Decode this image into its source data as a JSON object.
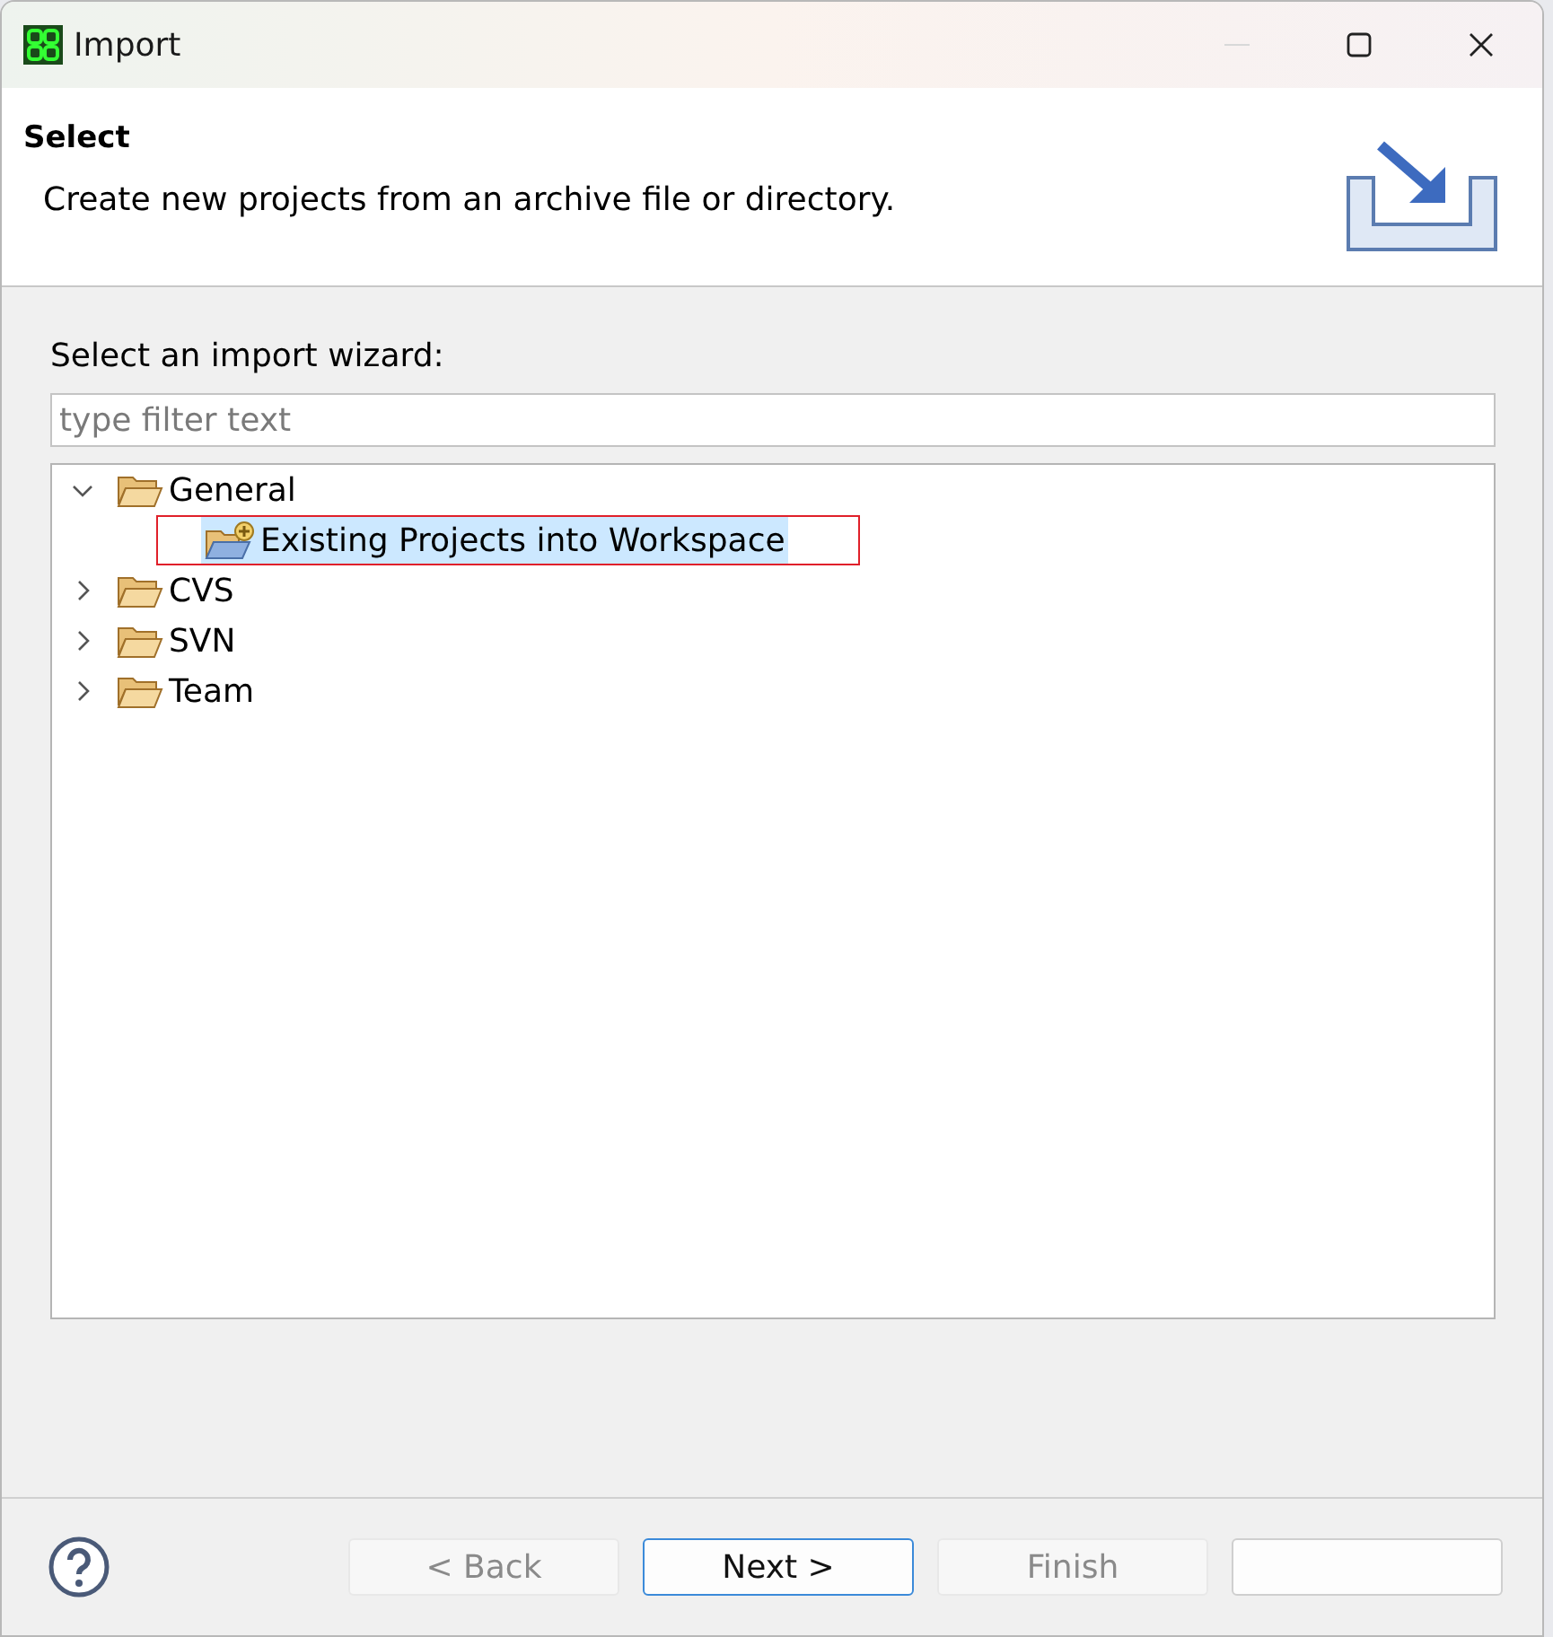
{
  "window": {
    "title": "Import",
    "minimize_disabled": true
  },
  "header": {
    "title": "Select",
    "description": "Create new projects from an archive file or directory."
  },
  "wizard": {
    "label": "Select an import wizard:",
    "filter": {
      "placeholder": "type filter text"
    }
  },
  "tree": [
    {
      "label": "General",
      "expanded": true,
      "children": [
        {
          "label": "Existing Projects into Workspace",
          "selected": true,
          "highlighted": true
        }
      ]
    },
    {
      "label": "CVS",
      "expanded": false
    },
    {
      "label": "SVN",
      "expanded": false
    },
    {
      "label": "Team",
      "expanded": false
    }
  ],
  "buttons": [
    {
      "label": "< Back",
      "disabled": true,
      "default": false
    },
    {
      "label": "Next >",
      "disabled": false,
      "default": true
    },
    {
      "label": "Finish",
      "disabled": true,
      "default": false
    }
  ]
}
